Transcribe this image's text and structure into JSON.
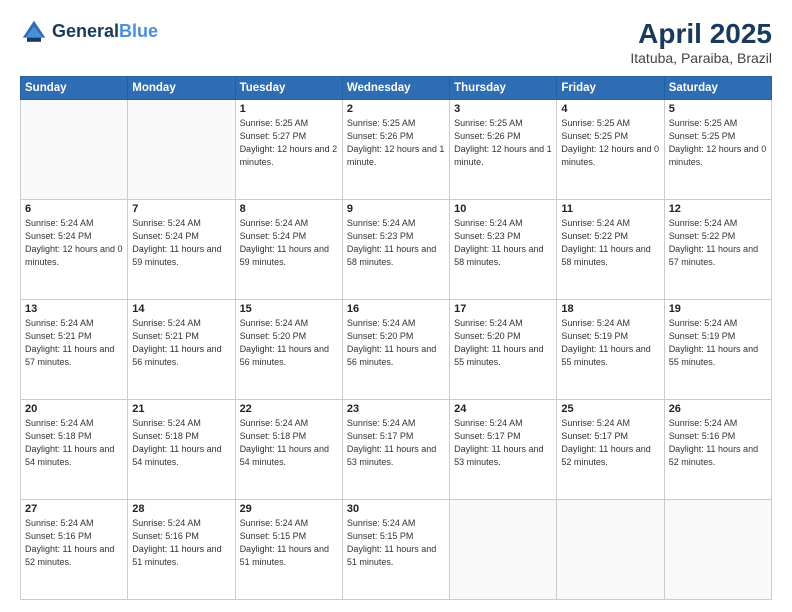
{
  "logo": {
    "line1": "General",
    "line2": "Blue"
  },
  "title": "April 2025",
  "location": "Itatuba, Paraiba, Brazil",
  "days_of_week": [
    "Sunday",
    "Monday",
    "Tuesday",
    "Wednesday",
    "Thursday",
    "Friday",
    "Saturday"
  ],
  "weeks": [
    [
      {
        "day": "",
        "info": ""
      },
      {
        "day": "",
        "info": ""
      },
      {
        "day": "1",
        "info": "Sunrise: 5:25 AM\nSunset: 5:27 PM\nDaylight: 12 hours and 2 minutes."
      },
      {
        "day": "2",
        "info": "Sunrise: 5:25 AM\nSunset: 5:26 PM\nDaylight: 12 hours and 1 minute."
      },
      {
        "day": "3",
        "info": "Sunrise: 5:25 AM\nSunset: 5:26 PM\nDaylight: 12 hours and 1 minute."
      },
      {
        "day": "4",
        "info": "Sunrise: 5:25 AM\nSunset: 5:25 PM\nDaylight: 12 hours and 0 minutes."
      },
      {
        "day": "5",
        "info": "Sunrise: 5:25 AM\nSunset: 5:25 PM\nDaylight: 12 hours and 0 minutes."
      }
    ],
    [
      {
        "day": "6",
        "info": "Sunrise: 5:24 AM\nSunset: 5:24 PM\nDaylight: 12 hours and 0 minutes."
      },
      {
        "day": "7",
        "info": "Sunrise: 5:24 AM\nSunset: 5:24 PM\nDaylight: 11 hours and 59 minutes."
      },
      {
        "day": "8",
        "info": "Sunrise: 5:24 AM\nSunset: 5:24 PM\nDaylight: 11 hours and 59 minutes."
      },
      {
        "day": "9",
        "info": "Sunrise: 5:24 AM\nSunset: 5:23 PM\nDaylight: 11 hours and 58 minutes."
      },
      {
        "day": "10",
        "info": "Sunrise: 5:24 AM\nSunset: 5:23 PM\nDaylight: 11 hours and 58 minutes."
      },
      {
        "day": "11",
        "info": "Sunrise: 5:24 AM\nSunset: 5:22 PM\nDaylight: 11 hours and 58 minutes."
      },
      {
        "day": "12",
        "info": "Sunrise: 5:24 AM\nSunset: 5:22 PM\nDaylight: 11 hours and 57 minutes."
      }
    ],
    [
      {
        "day": "13",
        "info": "Sunrise: 5:24 AM\nSunset: 5:21 PM\nDaylight: 11 hours and 57 minutes."
      },
      {
        "day": "14",
        "info": "Sunrise: 5:24 AM\nSunset: 5:21 PM\nDaylight: 11 hours and 56 minutes."
      },
      {
        "day": "15",
        "info": "Sunrise: 5:24 AM\nSunset: 5:20 PM\nDaylight: 11 hours and 56 minutes."
      },
      {
        "day": "16",
        "info": "Sunrise: 5:24 AM\nSunset: 5:20 PM\nDaylight: 11 hours and 56 minutes."
      },
      {
        "day": "17",
        "info": "Sunrise: 5:24 AM\nSunset: 5:20 PM\nDaylight: 11 hours and 55 minutes."
      },
      {
        "day": "18",
        "info": "Sunrise: 5:24 AM\nSunset: 5:19 PM\nDaylight: 11 hours and 55 minutes."
      },
      {
        "day": "19",
        "info": "Sunrise: 5:24 AM\nSunset: 5:19 PM\nDaylight: 11 hours and 55 minutes."
      }
    ],
    [
      {
        "day": "20",
        "info": "Sunrise: 5:24 AM\nSunset: 5:18 PM\nDaylight: 11 hours and 54 minutes."
      },
      {
        "day": "21",
        "info": "Sunrise: 5:24 AM\nSunset: 5:18 PM\nDaylight: 11 hours and 54 minutes."
      },
      {
        "day": "22",
        "info": "Sunrise: 5:24 AM\nSunset: 5:18 PM\nDaylight: 11 hours and 54 minutes."
      },
      {
        "day": "23",
        "info": "Sunrise: 5:24 AM\nSunset: 5:17 PM\nDaylight: 11 hours and 53 minutes."
      },
      {
        "day": "24",
        "info": "Sunrise: 5:24 AM\nSunset: 5:17 PM\nDaylight: 11 hours and 53 minutes."
      },
      {
        "day": "25",
        "info": "Sunrise: 5:24 AM\nSunset: 5:17 PM\nDaylight: 11 hours and 52 minutes."
      },
      {
        "day": "26",
        "info": "Sunrise: 5:24 AM\nSunset: 5:16 PM\nDaylight: 11 hours and 52 minutes."
      }
    ],
    [
      {
        "day": "27",
        "info": "Sunrise: 5:24 AM\nSunset: 5:16 PM\nDaylight: 11 hours and 52 minutes."
      },
      {
        "day": "28",
        "info": "Sunrise: 5:24 AM\nSunset: 5:16 PM\nDaylight: 11 hours and 51 minutes."
      },
      {
        "day": "29",
        "info": "Sunrise: 5:24 AM\nSunset: 5:15 PM\nDaylight: 11 hours and 51 minutes."
      },
      {
        "day": "30",
        "info": "Sunrise: 5:24 AM\nSunset: 5:15 PM\nDaylight: 11 hours and 51 minutes."
      },
      {
        "day": "",
        "info": ""
      },
      {
        "day": "",
        "info": ""
      },
      {
        "day": "",
        "info": ""
      }
    ]
  ]
}
